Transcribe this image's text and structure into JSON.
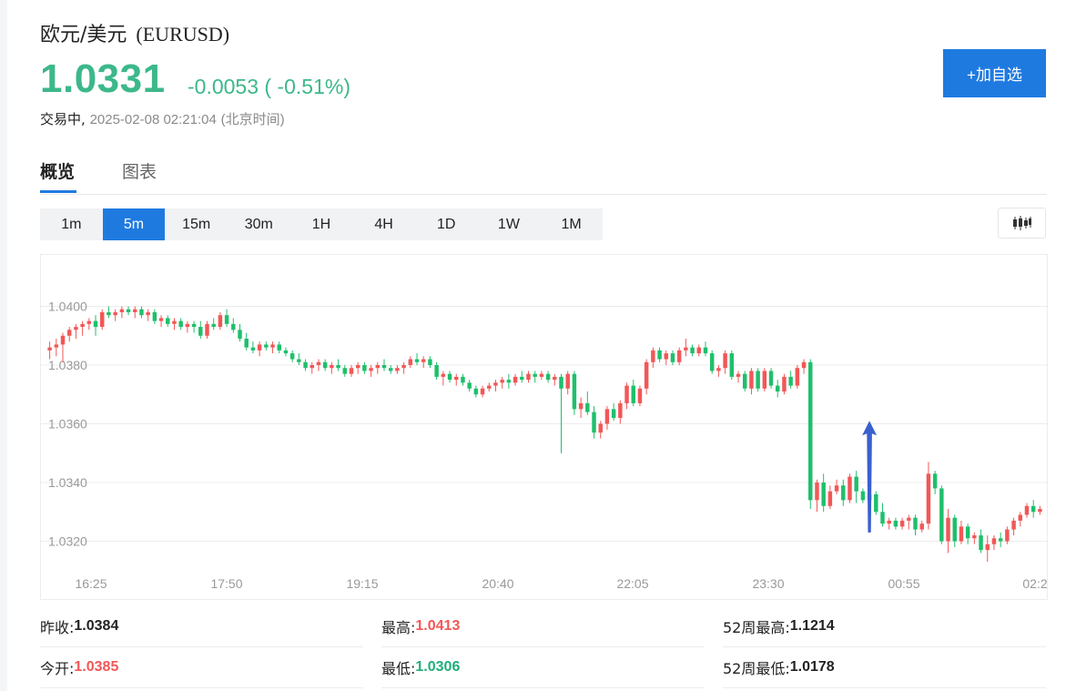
{
  "header": {
    "name": "欧元/美元",
    "code": "(EURUSD)",
    "price": "1.0331",
    "change": "-0.0053 ( -0.51%)",
    "status": "交易中,",
    "timestamp": "2025-02-08 02:21:04",
    "timezone": "(北京时间)",
    "watch_label": "+加自选"
  },
  "tabs": [
    {
      "label": "概览",
      "active": true
    },
    {
      "label": "图表",
      "active": false
    }
  ],
  "ranges": [
    "1m",
    "5m",
    "15m",
    "30m",
    "1H",
    "4H",
    "1D",
    "1W",
    "1M"
  ],
  "active_range": "5m",
  "icons": {
    "chart_type": "candlestick-icon",
    "annotation": "up-arrow-icon"
  },
  "colors": {
    "up": "#f25757",
    "down": "#1fbf6c",
    "accent": "#1f7ae0",
    "price_down": "#3cb88a",
    "arrow": "#3a5fcf"
  },
  "stats": [
    {
      "label": "昨收:",
      "value": "1.0384",
      "tone": "neutral"
    },
    {
      "label": "最高:",
      "value": "1.0413",
      "tone": "up"
    },
    {
      "label": "52周最高:",
      "value": "1.1214",
      "tone": "neutral"
    },
    {
      "label": "今开:",
      "value": "1.0385",
      "tone": "up"
    },
    {
      "label": "最低:",
      "value": "1.0306",
      "tone": "down"
    },
    {
      "label": "52周最低:",
      "value": "1.0178",
      "tone": "neutral"
    }
  ],
  "chart_data": {
    "type": "candlestick",
    "interval": "5m",
    "y_ticks": [
      "1.0400",
      "1.0380",
      "1.0360",
      "1.0340",
      "1.0320"
    ],
    "ylim": [
      1.0306,
      1.0413
    ],
    "x_ticks": [
      "16:25",
      "17:50",
      "19:15",
      "20:40",
      "22:05",
      "23:30",
      "00:55",
      "02:2"
    ],
    "grid": true,
    "candles": [
      [
        1.0385,
        1.0388,
        1.0382,
        1.0386
      ],
      [
        1.0386,
        1.0389,
        1.0383,
        1.0387
      ],
      [
        1.0387,
        1.0391,
        1.0381,
        1.039
      ],
      [
        1.039,
        1.0393,
        1.0388,
        1.0392
      ],
      [
        1.0392,
        1.0394,
        1.0389,
        1.0393
      ],
      [
        1.0393,
        1.0395,
        1.039,
        1.0394
      ],
      [
        1.0394,
        1.0396,
        1.0392,
        1.0395
      ],
      [
        1.0395,
        1.0397,
        1.039,
        1.0393
      ],
      [
        1.0393,
        1.0399,
        1.0392,
        1.0398
      ],
      [
        1.0398,
        1.04,
        1.0396,
        1.0397
      ],
      [
        1.0397,
        1.0399,
        1.0395,
        1.0398
      ],
      [
        1.0398,
        1.04,
        1.0396,
        1.0399
      ],
      [
        1.0399,
        1.04,
        1.0397,
        1.0398
      ],
      [
        1.0398,
        1.04,
        1.0396,
        1.0399
      ],
      [
        1.0399,
        1.04,
        1.0396,
        1.0397
      ],
      [
        1.0397,
        1.0399,
        1.0395,
        1.0398
      ],
      [
        1.0398,
        1.0399,
        1.0394,
        1.0395
      ],
      [
        1.0395,
        1.0397,
        1.0393,
        1.0396
      ],
      [
        1.0396,
        1.0397,
        1.0393,
        1.0394
      ],
      [
        1.0394,
        1.0396,
        1.0392,
        1.0395
      ],
      [
        1.0395,
        1.0396,
        1.0392,
        1.0393
      ],
      [
        1.0393,
        1.0395,
        1.0391,
        1.0394
      ],
      [
        1.0394,
        1.0395,
        1.0391,
        1.0393
      ],
      [
        1.0393,
        1.0395,
        1.0389,
        1.039
      ],
      [
        1.039,
        1.0395,
        1.0389,
        1.0394
      ],
      [
        1.0394,
        1.0396,
        1.0392,
        1.0393
      ],
      [
        1.0393,
        1.0398,
        1.0392,
        1.0397
      ],
      [
        1.0397,
        1.0399,
        1.0393,
        1.0394
      ],
      [
        1.0394,
        1.0396,
        1.0391,
        1.0392
      ],
      [
        1.0392,
        1.0394,
        1.0388,
        1.0389
      ],
      [
        1.0389,
        1.0391,
        1.0385,
        1.0386
      ],
      [
        1.0386,
        1.0388,
        1.0384,
        1.0385
      ],
      [
        1.0385,
        1.0388,
        1.0383,
        1.0387
      ],
      [
        1.0387,
        1.0388,
        1.0385,
        1.0386
      ],
      [
        1.0386,
        1.0388,
        1.0384,
        1.0387
      ],
      [
        1.0387,
        1.0388,
        1.0384,
        1.0385
      ],
      [
        1.0385,
        1.0386,
        1.0383,
        1.0384
      ],
      [
        1.0384,
        1.0385,
        1.0381,
        1.0382
      ],
      [
        1.0382,
        1.0384,
        1.038,
        1.0381
      ],
      [
        1.0381,
        1.0382,
        1.0378,
        1.0379
      ],
      [
        1.0379,
        1.0381,
        1.0377,
        1.038
      ],
      [
        1.038,
        1.0382,
        1.0378,
        1.0381
      ],
      [
        1.0381,
        1.0382,
        1.0378,
        1.0379
      ],
      [
        1.0379,
        1.0381,
        1.0377,
        1.038
      ],
      [
        1.038,
        1.0382,
        1.0378,
        1.0379
      ],
      [
        1.0379,
        1.038,
        1.0376,
        1.0377
      ],
      [
        1.0377,
        1.038,
        1.0376,
        1.0379
      ],
      [
        1.0379,
        1.0381,
        1.0377,
        1.038
      ],
      [
        1.038,
        1.0381,
        1.0377,
        1.0378
      ],
      [
        1.0378,
        1.038,
        1.0376,
        1.0379
      ],
      [
        1.0379,
        1.0381,
        1.0377,
        1.038
      ],
      [
        1.038,
        1.0382,
        1.0378,
        1.0379
      ],
      [
        1.0379,
        1.038,
        1.0377,
        1.0378
      ],
      [
        1.0378,
        1.038,
        1.0377,
        1.0379
      ],
      [
        1.0379,
        1.0381,
        1.0377,
        1.038
      ],
      [
        1.038,
        1.0383,
        1.0379,
        1.0382
      ],
      [
        1.0382,
        1.0384,
        1.038,
        1.0381
      ],
      [
        1.0381,
        1.0383,
        1.0379,
        1.0382
      ],
      [
        1.0382,
        1.0383,
        1.0379,
        1.038
      ],
      [
        1.038,
        1.0381,
        1.0375,
        1.0376
      ],
      [
        1.0376,
        1.0378,
        1.0373,
        1.0377
      ],
      [
        1.0377,
        1.0378,
        1.0374,
        1.0375
      ],
      [
        1.0375,
        1.0377,
        1.0373,
        1.0376
      ],
      [
        1.0376,
        1.0377,
        1.0373,
        1.0374
      ],
      [
        1.0374,
        1.0375,
        1.0371,
        1.0372
      ],
      [
        1.0372,
        1.0373,
        1.0369,
        1.037
      ],
      [
        1.037,
        1.0373,
        1.0369,
        1.0372
      ],
      [
        1.0372,
        1.0374,
        1.0371,
        1.0373
      ],
      [
        1.0373,
        1.0375,
        1.0371,
        1.0374
      ],
      [
        1.0374,
        1.0376,
        1.0372,
        1.0375
      ],
      [
        1.0375,
        1.0377,
        1.0372,
        1.0374
      ],
      [
        1.0374,
        1.0377,
        1.0373,
        1.0376
      ],
      [
        1.0376,
        1.0378,
        1.0374,
        1.0375
      ],
      [
        1.0375,
        1.0378,
        1.0374,
        1.0377
      ],
      [
        1.0377,
        1.0378,
        1.0374,
        1.0376
      ],
      [
        1.0376,
        1.0378,
        1.0375,
        1.0377
      ],
      [
        1.0377,
        1.0378,
        1.0374,
        1.0375
      ],
      [
        1.0375,
        1.0377,
        1.0373,
        1.0376
      ],
      [
        1.0376,
        1.0377,
        1.035,
        1.0372
      ],
      [
        1.0372,
        1.0378,
        1.037,
        1.0377
      ],
      [
        1.0377,
        1.0378,
        1.0363,
        1.0365
      ],
      [
        1.0365,
        1.0369,
        1.0362,
        1.0367
      ],
      [
        1.0367,
        1.0371,
        1.0363,
        1.0364
      ],
      [
        1.0364,
        1.0366,
        1.0355,
        1.0357
      ],
      [
        1.0357,
        1.0361,
        1.0355,
        1.036
      ],
      [
        1.036,
        1.0366,
        1.0358,
        1.0365
      ],
      [
        1.0365,
        1.0367,
        1.0361,
        1.0362
      ],
      [
        1.0362,
        1.0368,
        1.036,
        1.0367
      ],
      [
        1.0367,
        1.0374,
        1.0365,
        1.0373
      ],
      [
        1.0373,
        1.0375,
        1.0366,
        1.0367
      ],
      [
        1.0367,
        1.0373,
        1.0366,
        1.0372
      ],
      [
        1.0372,
        1.0382,
        1.037,
        1.0381
      ],
      [
        1.0381,
        1.0386,
        1.0379,
        1.0385
      ],
      [
        1.0385,
        1.0386,
        1.0381,
        1.0382
      ],
      [
        1.0382,
        1.0385,
        1.038,
        1.0384
      ],
      [
        1.0384,
        1.0385,
        1.038,
        1.0381
      ],
      [
        1.0381,
        1.0386,
        1.038,
        1.0385
      ],
      [
        1.0385,
        1.0389,
        1.0383,
        1.0386
      ],
      [
        1.0386,
        1.0387,
        1.0383,
        1.0384
      ],
      [
        1.0384,
        1.0387,
        1.0383,
        1.0386
      ],
      [
        1.0386,
        1.0388,
        1.0383,
        1.0384
      ],
      [
        1.0384,
        1.0385,
        1.0377,
        1.0378
      ],
      [
        1.0378,
        1.038,
        1.0376,
        1.0379
      ],
      [
        1.0379,
        1.0385,
        1.0377,
        1.0384
      ],
      [
        1.0384,
        1.0385,
        1.0375,
        1.0376
      ],
      [
        1.0376,
        1.0378,
        1.0374,
        1.0377
      ],
      [
        1.0377,
        1.0378,
        1.0371,
        1.0372
      ],
      [
        1.0372,
        1.0379,
        1.037,
        1.0378
      ],
      [
        1.0378,
        1.0379,
        1.0371,
        1.0372
      ],
      [
        1.0372,
        1.0379,
        1.0371,
        1.0378
      ],
      [
        1.0378,
        1.0379,
        1.0372,
        1.0373
      ],
      [
        1.0373,
        1.0375,
        1.0369,
        1.0371
      ],
      [
        1.0371,
        1.0377,
        1.037,
        1.0376
      ],
      [
        1.0376,
        1.0378,
        1.0372,
        1.0373
      ],
      [
        1.0373,
        1.038,
        1.0372,
        1.0379
      ],
      [
        1.0379,
        1.0382,
        1.0377,
        1.0381
      ],
      [
        1.0381,
        1.0382,
        1.0331,
        1.0334
      ],
      [
        1.0334,
        1.0341,
        1.033,
        1.034
      ],
      [
        1.034,
        1.0343,
        1.033,
        1.0332
      ],
      [
        1.0332,
        1.0339,
        1.0331,
        1.0337
      ],
      [
        1.0337,
        1.0341,
        1.0336,
        1.0339
      ],
      [
        1.0339,
        1.0341,
        1.0332,
        1.0334
      ],
      [
        1.0334,
        1.0343,
        1.0333,
        1.0342
      ],
      [
        1.0342,
        1.0344,
        1.0333,
        1.0337
      ],
      [
        1.0337,
        1.0338,
        1.0333,
        1.0334
      ],
      [
        1.0334,
        1.0337,
        1.0332,
        1.0336
      ],
      [
        1.0336,
        1.0337,
        1.0329,
        1.033
      ],
      [
        1.033,
        1.0333,
        1.0325,
        1.0326
      ],
      [
        1.0326,
        1.0328,
        1.0324,
        1.0327
      ],
      [
        1.0327,
        1.0328,
        1.0324,
        1.0325
      ],
      [
        1.0325,
        1.0328,
        1.0324,
        1.0327
      ],
      [
        1.0327,
        1.0329,
        1.0324,
        1.0328
      ],
      [
        1.0328,
        1.0329,
        1.0322,
        1.0324
      ],
      [
        1.0324,
        1.0327,
        1.0323,
        1.0326
      ],
      [
        1.0326,
        1.0347,
        1.0324,
        1.0343
      ],
      [
        1.0343,
        1.0344,
        1.0336,
        1.0338
      ],
      [
        1.0338,
        1.0339,
        1.0319,
        1.032
      ],
      [
        1.032,
        1.0331,
        1.0316,
        1.0328
      ],
      [
        1.0328,
        1.0329,
        1.0318,
        1.032
      ],
      [
        1.032,
        1.0327,
        1.0319,
        1.0325
      ],
      [
        1.0325,
        1.0326,
        1.0319,
        1.0321
      ],
      [
        1.0321,
        1.0323,
        1.0319,
        1.0322
      ],
      [
        1.0322,
        1.0324,
        1.0316,
        1.0317
      ],
      [
        1.0317,
        1.0322,
        1.0313,
        1.0319
      ],
      [
        1.0319,
        1.0322,
        1.0317,
        1.0321
      ],
      [
        1.0321,
        1.0323,
        1.0318,
        1.032
      ],
      [
        1.032,
        1.0325,
        1.0319,
        1.0324
      ],
      [
        1.0324,
        1.0328,
        1.0322,
        1.0327
      ],
      [
        1.0327,
        1.033,
        1.0325,
        1.0329
      ],
      [
        1.0329,
        1.0333,
        1.0328,
        1.0332
      ],
      [
        1.0332,
        1.0334,
        1.0328,
        1.033
      ],
      [
        1.033,
        1.0332,
        1.0329,
        1.0331
      ]
    ],
    "annotation": {
      "type": "arrow",
      "at_index": 125,
      "from": 1.0323,
      "to": 1.0361
    }
  }
}
